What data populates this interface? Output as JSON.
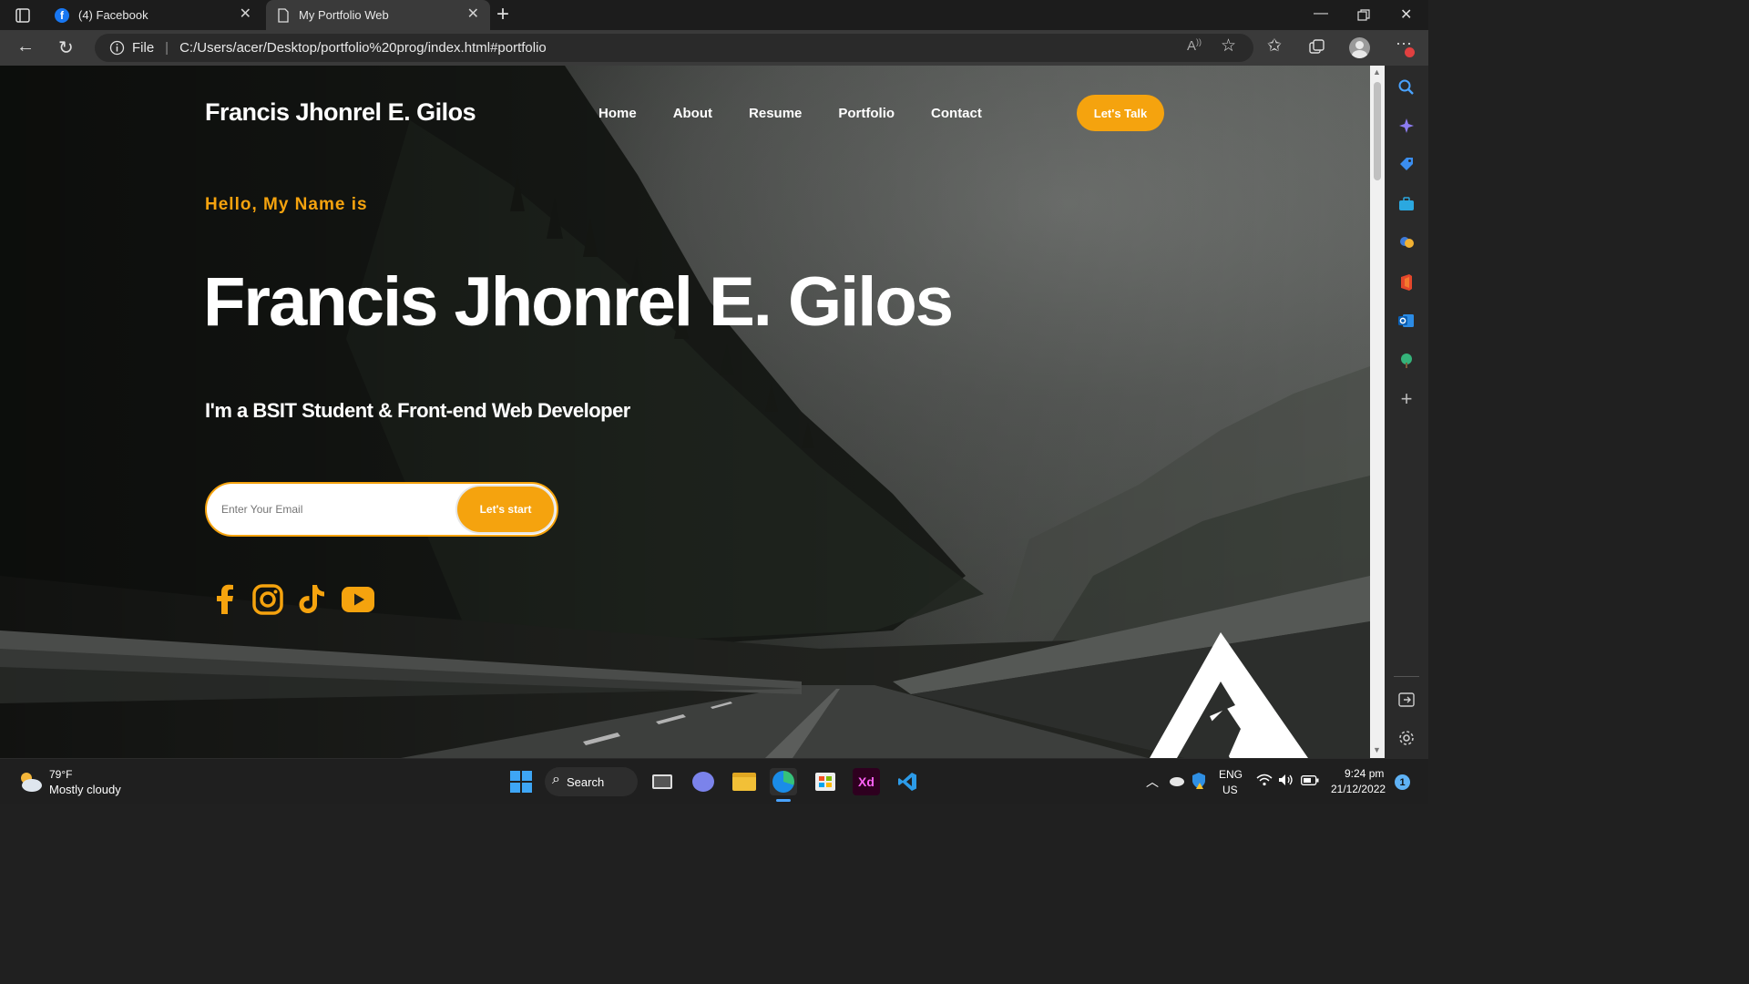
{
  "browser": {
    "tabs": [
      {
        "title": "(4) Facebook",
        "active": false
      },
      {
        "title": "My Portfolio Web",
        "active": true
      }
    ],
    "new_tab_label": "+",
    "address": {
      "scheme_label": "File",
      "url": "C:/Users/acer/Desktop/portfolio%20prog/index.html#portfolio"
    }
  },
  "site": {
    "brand": "Francis Jhonrel E. Gilos",
    "nav": [
      "Home",
      "About",
      "Resume",
      "Portfolio",
      "Contact"
    ],
    "cta": "Let's Talk",
    "hero": {
      "greeting": "Hello, My Name is",
      "name": "Francis Jhonrel E. Gilos",
      "tagline": "I'm a BSIT Student & Front-end Web Developer",
      "email_placeholder": "Enter Your Email",
      "start_button": "Let's start"
    },
    "socials": [
      "facebook-icon",
      "instagram-icon",
      "tiktok-icon",
      "youtube-icon"
    ],
    "accent_color": "#f5a30e"
  },
  "taskbar": {
    "weather_temp": "79°F",
    "weather_desc": "Mostly cloudy",
    "search_label": "Search",
    "lang_line1": "ENG",
    "lang_line2": "US",
    "time": "9:24 pm",
    "date": "21/12/2022",
    "xd_label": "Xd",
    "notification_count": "1"
  }
}
